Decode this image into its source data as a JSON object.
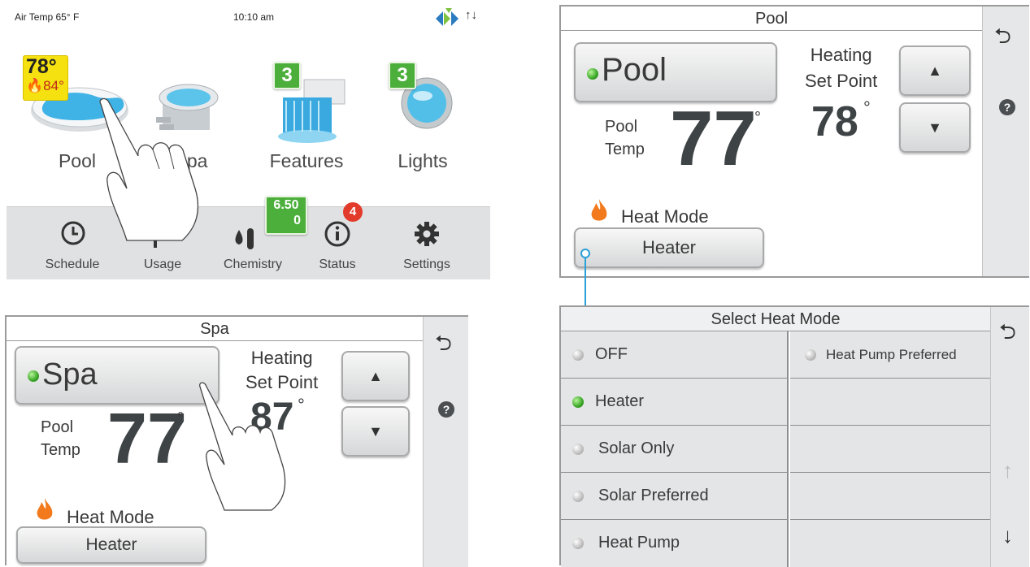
{
  "home": {
    "air_temp": "Air Temp 65° F",
    "time": "10:10 am",
    "tiles": [
      {
        "label": "Pool",
        "icon": "pool-icon",
        "temp": "78°",
        "heat": "84°"
      },
      {
        "label": "Spa",
        "icon": "spa-icon"
      },
      {
        "label": "Features",
        "icon": "waterfall-icon",
        "badge": "3"
      },
      {
        "label": "Lights",
        "icon": "light-icon",
        "badge": "3"
      }
    ],
    "nav": [
      {
        "label": "Schedule",
        "icon": "clock-icon"
      },
      {
        "label": "Usage",
        "icon": "usage-icon"
      },
      {
        "label": "Chemistry",
        "icon": "chemistry-icon",
        "badge_line1": "6.50",
        "badge_line2": "0"
      },
      {
        "label": "Status",
        "icon": "info-icon",
        "badge": "4"
      },
      {
        "label": "Settings",
        "icon": "gear-icon"
      }
    ]
  },
  "pool_panel": {
    "title": "Pool",
    "body_button": "Pool",
    "temp_label_1": "Pool",
    "temp_label_2": "Temp",
    "current_temp": "77",
    "setpoint_label_1": "Heating",
    "setpoint_label_2": "Set Point",
    "setpoint": "78",
    "heat_mode_label": "Heat Mode",
    "heat_mode_value": "Heater"
  },
  "spa_panel": {
    "title": "Spa",
    "body_button": "Spa",
    "temp_label_1": "Pool",
    "temp_label_2": "Temp",
    "current_temp": "77",
    "setpoint_label_1": "Heating",
    "setpoint_label_2": "Set Point",
    "setpoint": "87",
    "heat_mode_label": "Heat Mode",
    "heat_mode_value": "Heater"
  },
  "heat_mode_panel": {
    "title": "Select Heat Mode",
    "options": [
      {
        "label": "OFF",
        "selected": false
      },
      {
        "label": "Heater",
        "selected": true
      },
      {
        "label": "Solar Only",
        "selected": false
      },
      {
        "label": "Solar Preferred",
        "selected": false
      },
      {
        "label": "Heat Pump",
        "selected": false
      }
    ],
    "right_options": [
      {
        "label": "Heat Pump Preferred",
        "selected": false
      }
    ]
  },
  "colors": {
    "accent_green": "#4caf3c",
    "badge_yellow": "#f5e10f",
    "alert_red": "#e23a2b",
    "flame_orange": "#f27a1c",
    "connector_blue": "#2aa0d8"
  }
}
